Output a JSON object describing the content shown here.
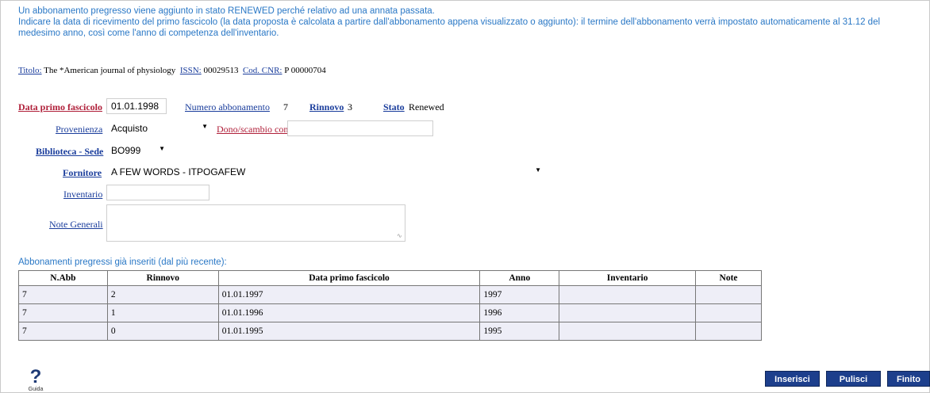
{
  "info": {
    "line1": "Un abbonamento pregresso viene aggiunto in stato RENEWED perché relativo ad una annata passata.",
    "line2": "Indicare la data di ricevimento del primo fascicolo (la data proposta è calcolata a partire dall'abbonamento appena visualizzato o aggiunto): il termine dell'abbonamento verrà impostato automaticamente al 31.12 del medesimo anno, così come l'anno di competenza dell'inventario."
  },
  "title_bar": {
    "titolo_label": "Titolo:",
    "titolo_value": "The *American journal of physiology",
    "issn_label": "ISSN:",
    "issn_value": "00029513",
    "cnr_label": "Cod. CNR:",
    "cnr_value": "P 00000704"
  },
  "form": {
    "data_primo_label": "Data primo fascicolo",
    "data_primo_value": "01.01.1998",
    "numero_label": "Numero abbonamento",
    "numero_value": "7",
    "rinnovo_label": "Rinnovo",
    "rinnovo_value": "3",
    "stato_label": "Stato",
    "stato_value": "Renewed",
    "provenienza_label": "Provenienza",
    "provenienza_value": "Acquisto",
    "dono_label": "Dono/scambio con",
    "dono_value": "",
    "biblioteca_label": "Biblioteca - Sede",
    "biblioteca_value": "BO999",
    "fornitore_label": "Fornitore",
    "fornitore_value": "A FEW WORDS - ITPOGAFEW",
    "inventario_label": "Inventario",
    "inventario_value": "",
    "note_label": "Note Generali",
    "note_value": ""
  },
  "table": {
    "caption": "Abbonamenti pregressi già inseriti (dal più recente):",
    "headers": [
      "N.Abb",
      "Rinnovo",
      "Data primo fascicolo",
      "Anno",
      "Inventario",
      "Note"
    ],
    "rows": [
      [
        "7",
        "2",
        "01.01.1997",
        "1997",
        "",
        ""
      ],
      [
        "7",
        "1",
        "01.01.1996",
        "1996",
        "",
        ""
      ],
      [
        "7",
        "0",
        "01.01.1995",
        "1995",
        "",
        ""
      ]
    ]
  },
  "help": {
    "label": "Guida",
    "glyph": "?"
  },
  "buttons": {
    "inserisci": "Inserisci",
    "pulisci": "Pulisci",
    "finito": "Finito"
  },
  "colors": {
    "info_text": "#2a78c6",
    "link": "#1a3d9c",
    "link_required": "#b0203a",
    "row_bg": "#eeeef7",
    "button_bg": "#1d3f8c"
  }
}
